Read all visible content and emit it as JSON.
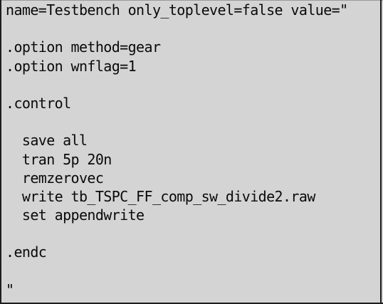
{
  "editor": {
    "lines": [
      "name=Testbench only_toplevel=false value=\"",
      "",
      ".option method=gear",
      ".option wnflag=1",
      "",
      ".control",
      "",
      "  save all",
      "  tran 5p 20n",
      "  remzerovec",
      "  write tb_TSPC_FF_comp_sw_divide2.raw",
      "  set appendwrite",
      "",
      ".endc",
      "",
      "\""
    ]
  },
  "colors": {
    "background": "#d4d4d4",
    "text": "#0a0a0a",
    "border": "#1e1e1e"
  }
}
